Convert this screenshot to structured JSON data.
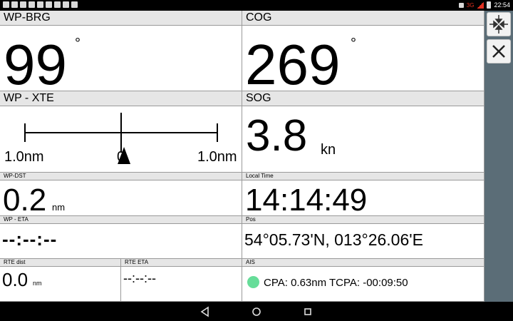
{
  "status": {
    "network": "3G",
    "time": "22:54"
  },
  "wp_brg": {
    "title": "WP-BRG",
    "value": "99",
    "unit": "°"
  },
  "cog": {
    "title": "COG",
    "value": "269",
    "unit": "°"
  },
  "wp_xte": {
    "title": "WP - XTE",
    "left_label": "1.0nm",
    "center_label": "0",
    "right_label": "1.0nm",
    "deviation_fraction": 0.03
  },
  "sog": {
    "title": "SOG",
    "value": "3.8",
    "unit": "kn"
  },
  "wp_dst": {
    "title": "WP-DST",
    "value": "0.2",
    "unit": "nm"
  },
  "local_time": {
    "title": "Local Time",
    "value": "14:14:49"
  },
  "wp_eta": {
    "title": "WP - ETA",
    "value": "--:--:--"
  },
  "pos": {
    "title": "Pos",
    "value": "54°05.73'N, 013°26.06'E"
  },
  "rte_dist": {
    "title": "RTE dist",
    "value": "0.0",
    "unit": "nm"
  },
  "rte_eta": {
    "title": "RTE ETA",
    "value": "--:--:--"
  },
  "ais": {
    "title": "AIS",
    "text": "CPA: 0.63nm TCPA: -00:09:50",
    "indicator_color": "#66dd99"
  },
  "sidebar": {
    "buttons": [
      "compress-icon",
      "close-icon"
    ]
  },
  "colors": {
    "header_bg": "#e6e6e6",
    "sidebar_bg": "#5b6d77"
  }
}
